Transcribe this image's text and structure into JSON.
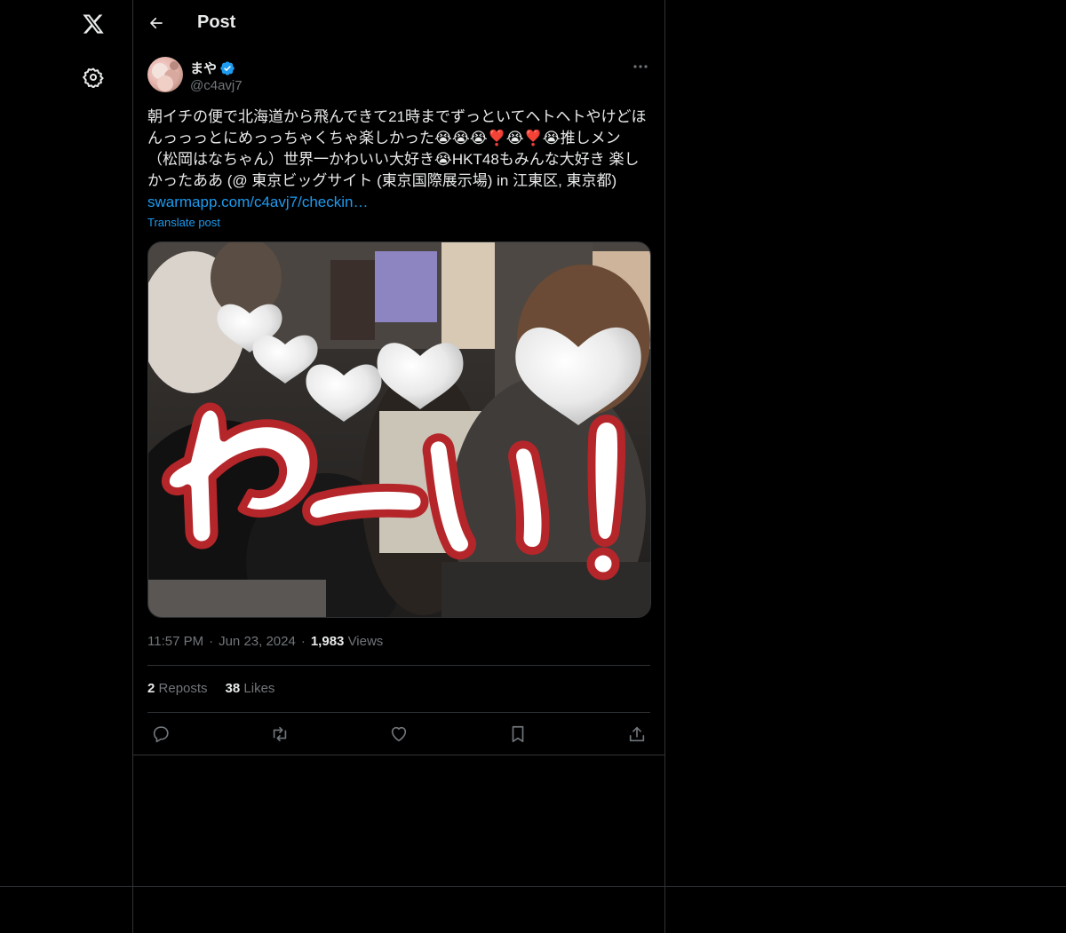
{
  "header": {
    "title": "Post"
  },
  "rail": {
    "logo_icon": "x-logo-icon",
    "settings_icon": "gear-icon"
  },
  "post": {
    "author": {
      "display_name": "まや",
      "handle": "@c4avj7",
      "verified": true
    },
    "text": "朝イチの便で北海道から飛んできて21時までずっといてヘトヘトやけどほんっっっとにめっっちゃくちゃ楽しかった😭😭😭❣️😭❣️😭推しメン（松岡はなちゃん）世界一かわいい大好き😭HKT48もみんな大好き 楽しかったああ (@ 東京ビッグサイト (東京国際展示場) in 江東区, 東京都)",
    "link": "swarmapp.com/c4avj7/checkin…",
    "translate_label": "Translate post",
    "media_caption": "わーい!",
    "time": "11:57 PM",
    "date": "Jun 23, 2024",
    "views_count": "1,983",
    "views_label": "Views",
    "reposts_count": "2",
    "reposts_label": "Reposts",
    "likes_count": "38",
    "likes_label": "Likes"
  },
  "colors": {
    "accent": "#1d9bf0",
    "text": "#e7e9ea",
    "muted": "#71767b",
    "border": "#2f3336"
  }
}
